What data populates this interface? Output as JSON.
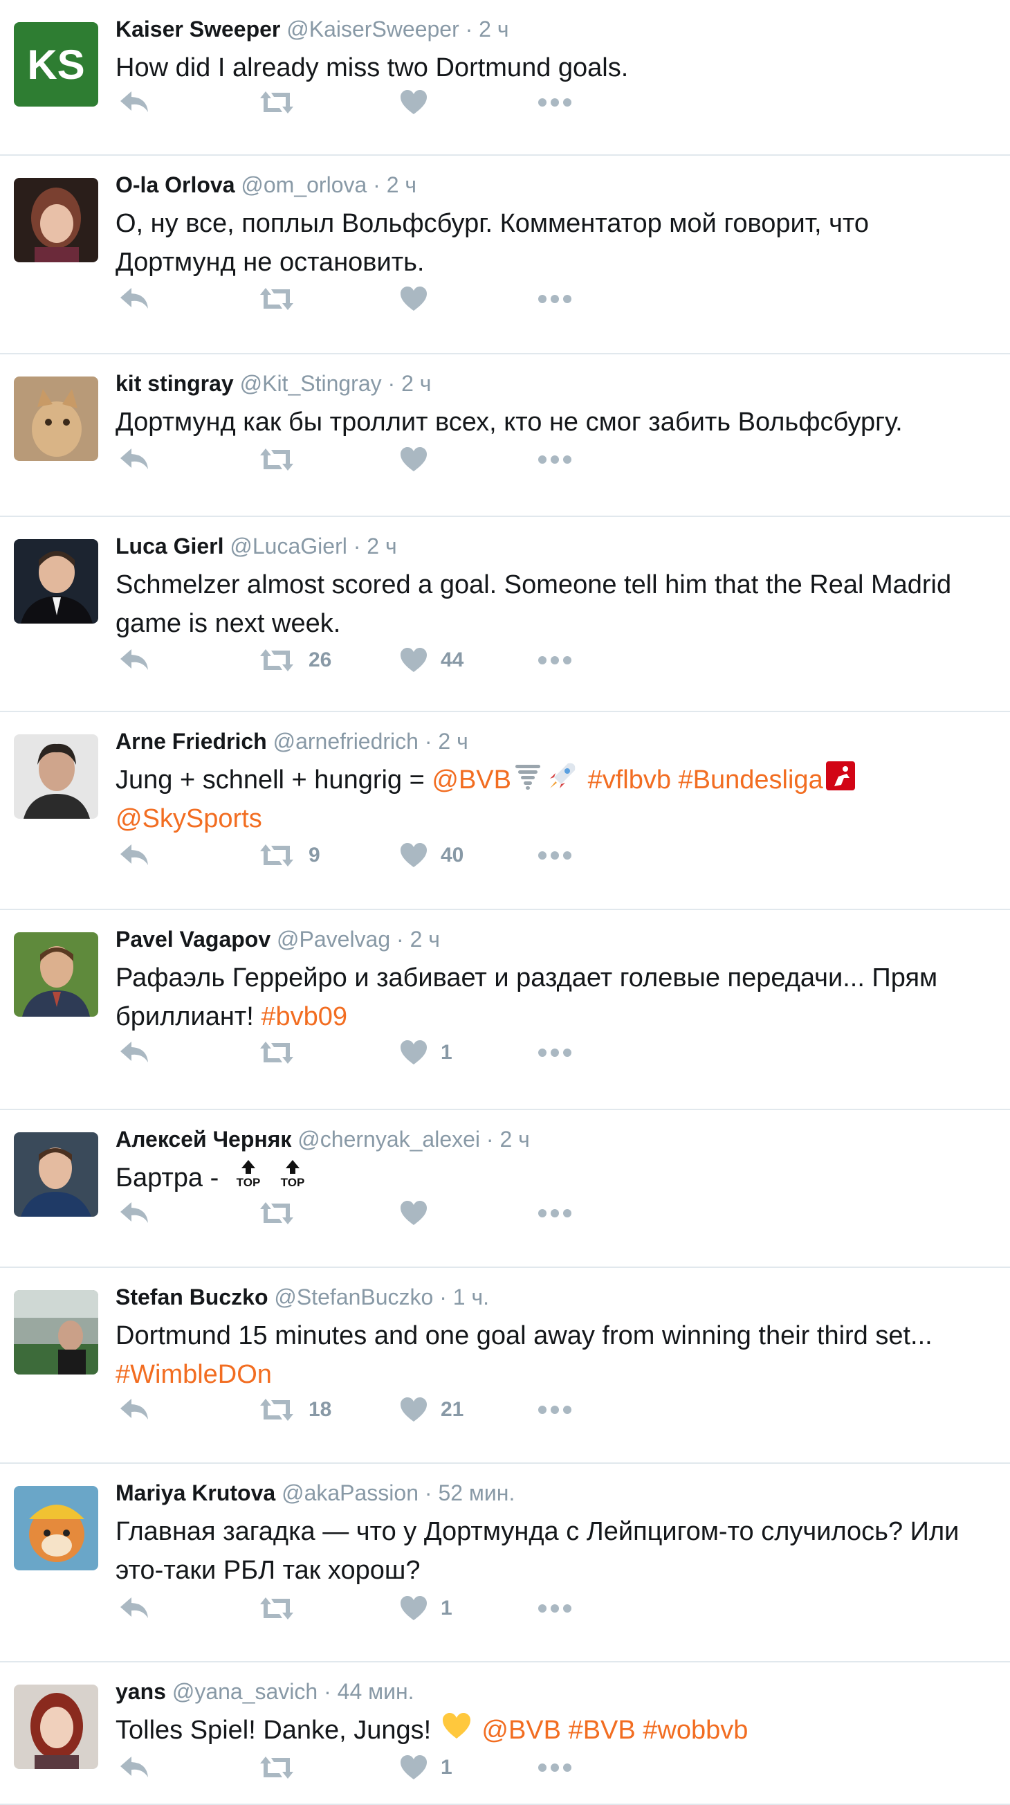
{
  "colors": {
    "link": "#f26d21",
    "meta": "#8899a6",
    "icon": "#aab8c2",
    "divider": "#e1e8ed"
  },
  "tweets": [
    {
      "name": "Kaiser Sweeper",
      "handle": "@KaiserSweeper",
      "separator": "·",
      "time": "2 ч",
      "avatar": "ks-logo-avatar",
      "avatar_text": "KS",
      "lines": [
        [
          {
            "t": "How did I already miss two Dortmund goals."
          }
        ]
      ],
      "retweets": "",
      "likes": ""
    },
    {
      "name": "O-la Orlova",
      "handle": "@om_orlova",
      "separator": "·",
      "time": "2 ч",
      "avatar": "woman-photo-avatar",
      "lines": [
        [
          {
            "t": "О, ну все, поплыл Вольфсбург. Комментатор мой говорит, что"
          }
        ],
        [
          {
            "t": "Дортмунд не остановить."
          }
        ]
      ],
      "retweets": "",
      "likes": ""
    },
    {
      "name": "kit stingray",
      "handle": "@Kit_Stingray",
      "separator": "·",
      "time": "2 ч",
      "avatar": "cat-photo-avatar",
      "lines": [
        [
          {
            "t": "Дортмунд как бы троллит всех, кто не смог забить Вольфсбургу."
          }
        ]
      ],
      "retweets": "",
      "likes": ""
    },
    {
      "name": "Luca Gierl",
      "handle": "@LucaGierl",
      "separator": "·",
      "time": "2 ч",
      "avatar": "man-suit-avatar",
      "lines": [
        [
          {
            "t": "Schmelzer almost scored a goal. Someone tell him that the Real Madrid"
          }
        ],
        [
          {
            "t": "game is next week."
          }
        ]
      ],
      "retweets": "26",
      "likes": "44"
    },
    {
      "name": "Arne Friedrich",
      "handle": "@arnefriedrich",
      "separator": "·",
      "time": "2 ч",
      "avatar": "man-portrait-avatar",
      "lines": [
        [
          {
            "t": "Jung + schnell + hungrig = "
          },
          {
            "t": "@BVB",
            "link": true
          },
          {
            "emoji": "tornado-emoji"
          },
          {
            "emoji": "rocket-emoji"
          },
          {
            "t": " "
          },
          {
            "t": "#vflbvb",
            "link": true
          },
          {
            "t": " "
          },
          {
            "t": "#Bundesliga",
            "link": true
          },
          {
            "emoji": "bundesliga-logo-emoji"
          }
        ],
        [
          {
            "t": "@SkySports",
            "link": true
          }
        ]
      ],
      "retweets": "9",
      "likes": "40"
    },
    {
      "name": "Pavel Vagapov",
      "handle": "@Pavelvag",
      "separator": "·",
      "time": "2 ч",
      "avatar": "man-outdoor-avatar",
      "lines": [
        [
          {
            "t": "Рафаэль Геррейро и забивает и раздает голевые передачи... Прям"
          }
        ],
        [
          {
            "t": "бриллиант! "
          },
          {
            "t": "#bvb09",
            "link": true
          }
        ]
      ],
      "retweets": "",
      "likes": "1"
    },
    {
      "name": "Алексей Черняк",
      "handle": "@chernyak_alexei",
      "separator": "·",
      "time": "2 ч",
      "avatar": "man-event-avatar",
      "lines": [
        [
          {
            "t": "Бартра - "
          },
          {
            "emoji": "top-arrow-emoji"
          },
          {
            "emoji": "top-arrow-emoji"
          }
        ]
      ],
      "retweets": "",
      "likes": ""
    },
    {
      "name": "Stefan Buczko",
      "handle": "@StefanBuczko",
      "separator": "·",
      "time": "1 ч.",
      "avatar": "stadium-photo-avatar",
      "lines": [
        [
          {
            "t": "Dortmund 15 minutes and one goal away from winning their third set..."
          }
        ],
        [
          {
            "t": "#WimbleDOn",
            "link": true
          }
        ]
      ],
      "retweets": "18",
      "likes": "21"
    },
    {
      "name": "Mariya Krutova",
      "handle": "@akaPassion",
      "separator": "·",
      "time": "52 мин.",
      "avatar": "cartoon-fox-avatar",
      "lines": [
        [
          {
            "t": "Главная загадка — что у Дортмунда с Лейпцигом-то случилось? Или"
          }
        ],
        [
          {
            "t": "это-таки РБЛ так хорош?"
          }
        ]
      ],
      "retweets": "",
      "likes": "1"
    },
    {
      "name": "yans",
      "handle": "@yana_savich",
      "separator": "·",
      "time": "44 мин.",
      "avatar": "woman-red-hair-avatar",
      "lines": [
        [
          {
            "t": "Tolles Spiel! Danke, Jungs! "
          },
          {
            "emoji": "yellow-heart-emoji"
          },
          {
            "t": " "
          },
          {
            "t": "@BVB",
            "link": true
          },
          {
            "t": " "
          },
          {
            "t": "#BVB",
            "link": true
          },
          {
            "t": " "
          },
          {
            "t": "#wobbvb",
            "link": true
          }
        ]
      ],
      "retweets": "",
      "likes": "1"
    }
  ]
}
